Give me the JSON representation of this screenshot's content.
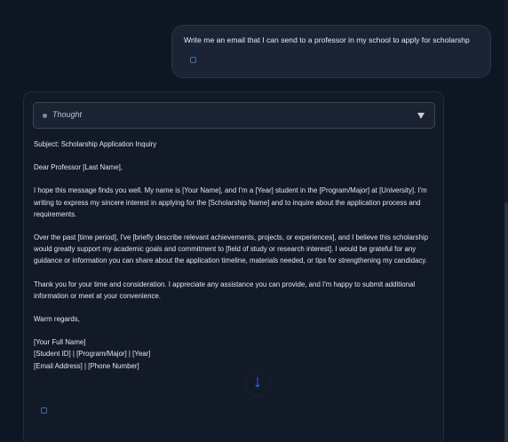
{
  "user_message": {
    "text": "Write me an email that I can send to a professor in my school to apply for scholarshp"
  },
  "assistant": {
    "thought_label": "Thought",
    "email": {
      "subject": "Subject: Scholarship Application Inquiry",
      "greeting": "Dear Professor [Last Name],",
      "paragraph_1": "I hope this message finds you well. My name is [Your Name], and I'm a [Year] student in the [Program/Major] at [University]. I'm writing to express my sincere interest in applying for the [Scholarship Name] and to inquire about the application process and requirements.",
      "paragraph_2": "Over the past [time period], I've [briefly describe relevant achievements, projects, or experiences], and I believe this scholarship would greatly support my academic goals and commitment to [field of study or research interest]. I would be grateful for any guidance or information you can share about the application timeline, materials needed, or tips for strengthening my candidacy.",
      "paragraph_3": "Thank you for your time and consideration. I appreciate any assistance you can provide, and I'm happy to submit additional information or meet at your convenience.",
      "closing": "Warm regards,",
      "signature_line_1": "[Your Full Name]",
      "signature_line_2": "[Student ID] | [Program/Major] | [Year]",
      "signature_line_3": "[Email Address] | [Phone Number]"
    },
    "scroll_down_glyph": "↓"
  },
  "colors": {
    "background": "#0f1623",
    "accent": "#2f6fe8"
  }
}
